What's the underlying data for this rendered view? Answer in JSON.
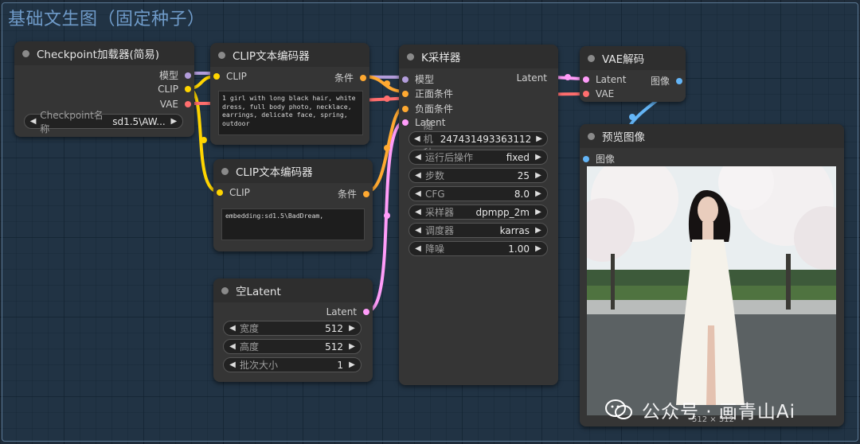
{
  "group": {
    "title": "基础文生图（固定种子）"
  },
  "checkpoint": {
    "title": "Checkpoint加载器(简易)",
    "outputs": [
      "模型",
      "CLIP",
      "VAE"
    ],
    "widget_label": "Checkpoint名称",
    "widget_value": "sd1.5\\AW..."
  },
  "clip_pos": {
    "title": "CLIP文本编码器",
    "input": "CLIP",
    "output": "条件",
    "text": "1 girl with long black hair, white dress, full body photo, necklace, earrings, delicate face, spring, outdoor"
  },
  "clip_neg": {
    "title": "CLIP文本编码器",
    "input": "CLIP",
    "output": "条件",
    "text": "embedding:sd1.5\\BadDream,"
  },
  "empty_latent": {
    "title": "空Latent",
    "output": "Latent",
    "widgets": [
      {
        "label": "宽度",
        "value": "512"
      },
      {
        "label": "高度",
        "value": "512"
      },
      {
        "label": "批次大小",
        "value": "1"
      }
    ]
  },
  "ksampler": {
    "title": "K采样器",
    "inputs": [
      "模型",
      "正面条件",
      "负面条件",
      "Latent"
    ],
    "output": "Latent",
    "widgets": [
      {
        "label": "随机种",
        "value": "247431493363112"
      },
      {
        "label": "运行后操作",
        "value": "fixed"
      },
      {
        "label": "步数",
        "value": "25"
      },
      {
        "label": "CFG",
        "value": "8.0"
      },
      {
        "label": "采样器",
        "value": "dpmpp_2m"
      },
      {
        "label": "调度器",
        "value": "karras"
      },
      {
        "label": "降噪",
        "value": "1.00"
      }
    ]
  },
  "vae_decode": {
    "title": "VAE解码",
    "inputs": [
      "Latent",
      "VAE"
    ],
    "output": "图像"
  },
  "preview": {
    "title": "预览图像",
    "input": "图像",
    "size_label": "512 × 512"
  },
  "watermark": {
    "text": "公众号 · 画青山Ai"
  },
  "colors": {
    "model": "#b39ddb",
    "clip": "#ffd500",
    "vae": "#ff6e6e",
    "conditioning": "#ffa931",
    "latent": "#ff9cf9",
    "image": "#64b5f6"
  }
}
